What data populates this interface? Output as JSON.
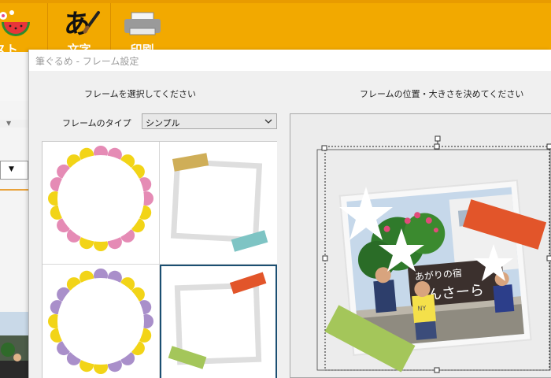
{
  "toolbar": {
    "illust_label": "ラスト",
    "text_label": "文字",
    "print_label": "印刷"
  },
  "dialog": {
    "title": "筆ぐるめ - フレーム設定",
    "left_heading": "フレームを選択してください",
    "right_heading": "フレームの位置・大きさを決めてください",
    "frame_type_label": "フレームのタイプ",
    "frame_type_value": "シンプル"
  },
  "frames": [
    {
      "name": "flower-circle-pink-yellow",
      "selected": false
    },
    {
      "name": "tape-frame-yellow-blue",
      "selected": false
    },
    {
      "name": "flower-circle-purple-yellow",
      "selected": false
    },
    {
      "name": "tape-frame-orange-green",
      "selected": true
    }
  ],
  "photo": {
    "sign_text_1": "あがりの宿",
    "sign_text_2": "さんさーら",
    "shirt_text": "NY"
  },
  "colors": {
    "toolbar": "#f2a900",
    "selected_border": "#1b4f72",
    "tape_orange": "#e2552a",
    "tape_green": "#a4c65a"
  }
}
